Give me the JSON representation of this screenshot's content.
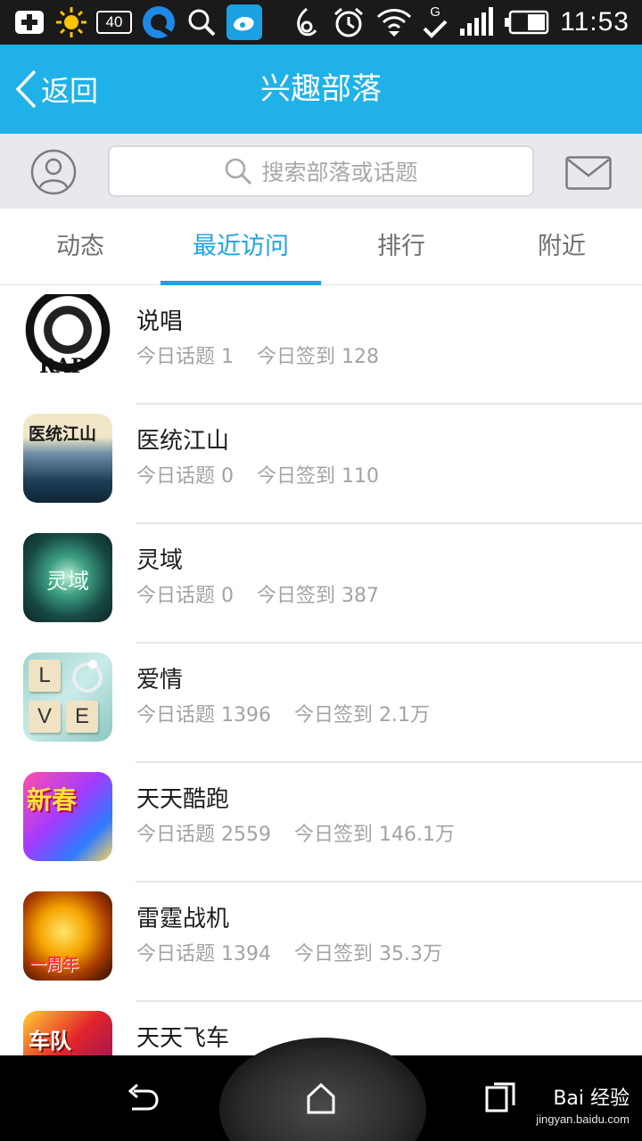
{
  "status_bar": {
    "badge_number": "40",
    "time": "11:53",
    "network_label": "G",
    "left_icons": [
      "add-icon",
      "sun-icon",
      "badge-40-icon",
      "qq-browser-icon",
      "search-icon",
      "weibo-icon"
    ],
    "right_icons": [
      "nfc-icon",
      "alarm-icon",
      "wifi-icon",
      "check-icon",
      "signal-icon",
      "battery-icon"
    ]
  },
  "header": {
    "back_label": "返回",
    "title": "兴趣部落",
    "background_color": "#1fb1e8"
  },
  "search": {
    "placeholder": "搜索部落或话题"
  },
  "tabs": [
    {
      "label": "动态",
      "active": false
    },
    {
      "label": "最近访问",
      "active": true
    },
    {
      "label": "排行",
      "active": false
    },
    {
      "label": "附近",
      "active": false
    }
  ],
  "accent_color": "#1fa4e0",
  "list": [
    {
      "name": "说唱",
      "topics": "今日话题 1",
      "checkins": "今日签到 128",
      "thumb_text": "RAP"
    },
    {
      "name": "医统江山",
      "topics": "今日话题 0",
      "checkins": "今日签到 110",
      "thumb_text": "医统江山"
    },
    {
      "name": "灵域",
      "topics": "今日话题 0",
      "checkins": "今日签到 387",
      "thumb_text": "灵域"
    },
    {
      "name": "爱情",
      "topics": "今日话题 1396",
      "checkins": "今日签到 2.1万",
      "thumb_tiles": [
        "L",
        "V",
        "E"
      ]
    },
    {
      "name": "天天酷跑",
      "topics": "今日话题 2559",
      "checkins": "今日签到 146.1万",
      "thumb_text": "新春"
    },
    {
      "name": "雷霆战机",
      "topics": "今日话题 1394",
      "checkins": "今日签到 35.3万",
      "thumb_text": "一周年"
    },
    {
      "name": "天天飞车",
      "thumb_text": "车队"
    }
  ],
  "nav": {
    "watermark_main": "Bai 经验",
    "watermark_url": "jingyan.baidu.com"
  }
}
